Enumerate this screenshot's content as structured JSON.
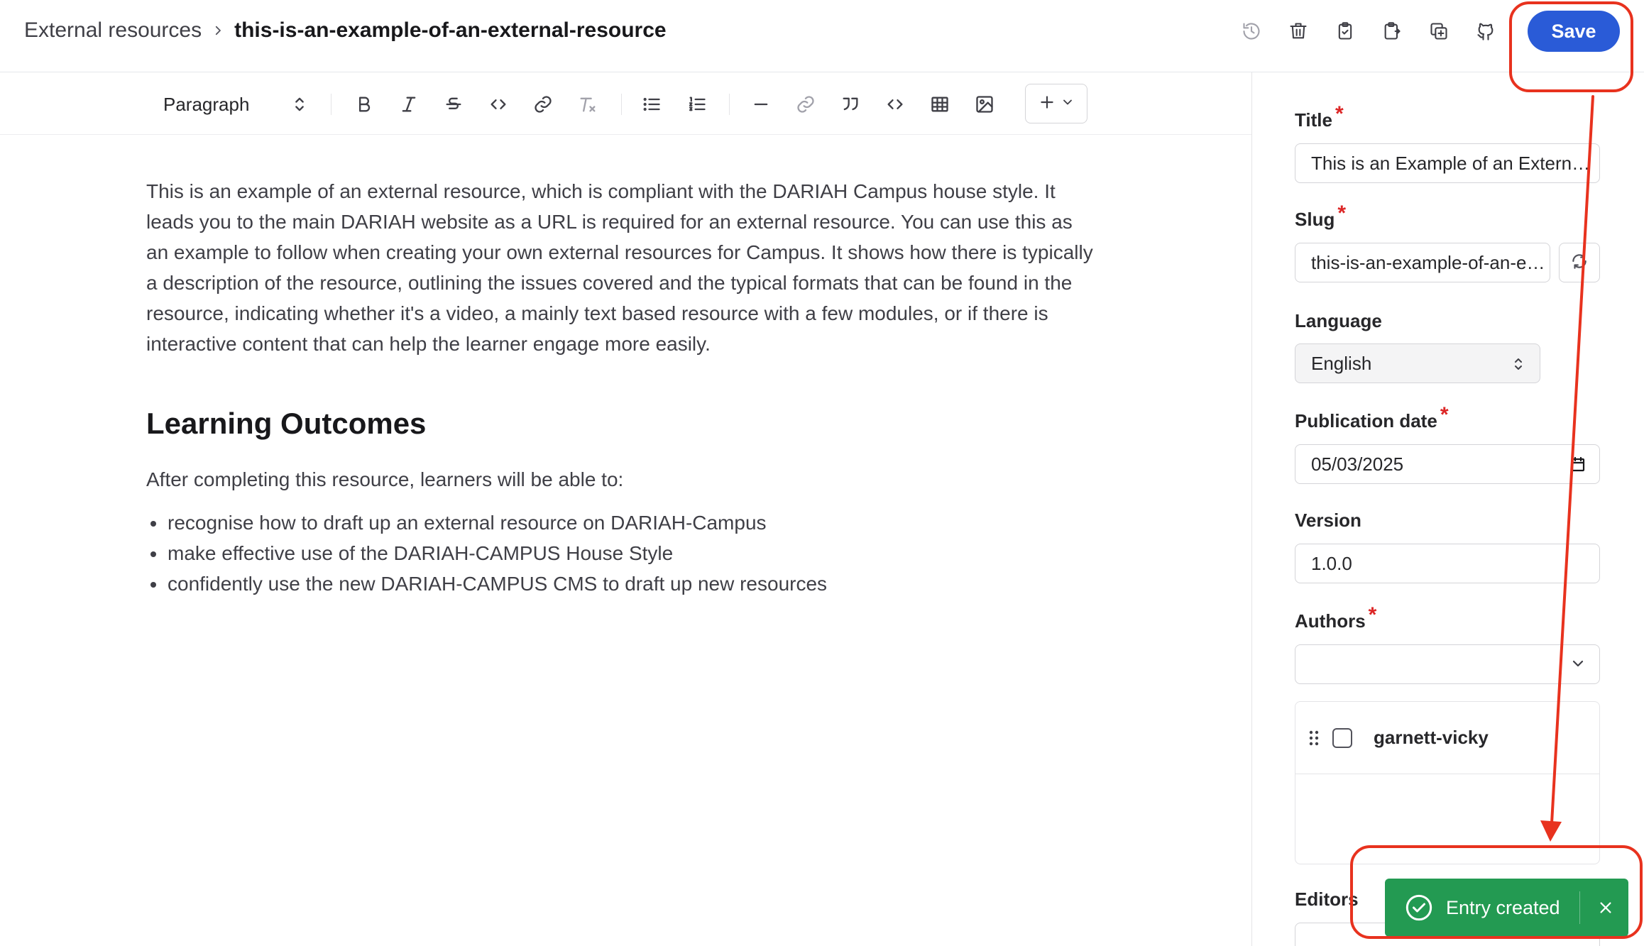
{
  "breadcrumb": {
    "parent": "External resources",
    "current": "this-is-an-example-of-an-external-resource"
  },
  "header": {
    "save_label": "Save",
    "icons": [
      "history-icon",
      "trash-icon",
      "clipboard-icon",
      "export-icon",
      "duplicate-icon",
      "github-icon"
    ]
  },
  "toolbar": {
    "block_type": "Paragraph"
  },
  "editor": {
    "paragraph": "This is an example of an external resource, which is compliant with the DARIAH Campus house style.  It leads you to the main DARIAH website as a URL is required for an external resource.  You can use this as an example to follow when creating your own external resources for Campus.  It shows how there is typically a description of the resource, outlining the issues covered and the typical formats that can be found in the resource, indicating whether it's a video, a mainly text based resource with a few modules, or if there is interactive content that can help the learner engage more easily.",
    "heading": "Learning Outcomes",
    "intro": "After completing this resource, learners will be able to:",
    "bullets": [
      "recognise how to draft up an external resource on DARIAH-Campus",
      "make effective use of the DARIAH-CAMPUS House Style",
      "confidently use the new DARIAH-CAMPUS CMS to draft up new resources"
    ]
  },
  "panel": {
    "title_label": "Title",
    "title_value": "This is an Example of an External Resource",
    "slug_label": "Slug",
    "slug_value": "this-is-an-example-of-an-external-resource",
    "language_label": "Language",
    "language_value": "English",
    "pubdate_label": "Publication date",
    "pubdate_value": "05/03/2025",
    "version_label": "Version",
    "version_value": "1.0.0",
    "authors_label": "Authors",
    "authors_value": "",
    "authors": [
      "garnett-vicky"
    ],
    "editors_label": "Editors"
  },
  "toast": {
    "message": "Entry created"
  },
  "colors": {
    "accent": "#2a5bd7",
    "success": "#239a52",
    "annotation": "#e8321e",
    "required": "#dc2626"
  }
}
